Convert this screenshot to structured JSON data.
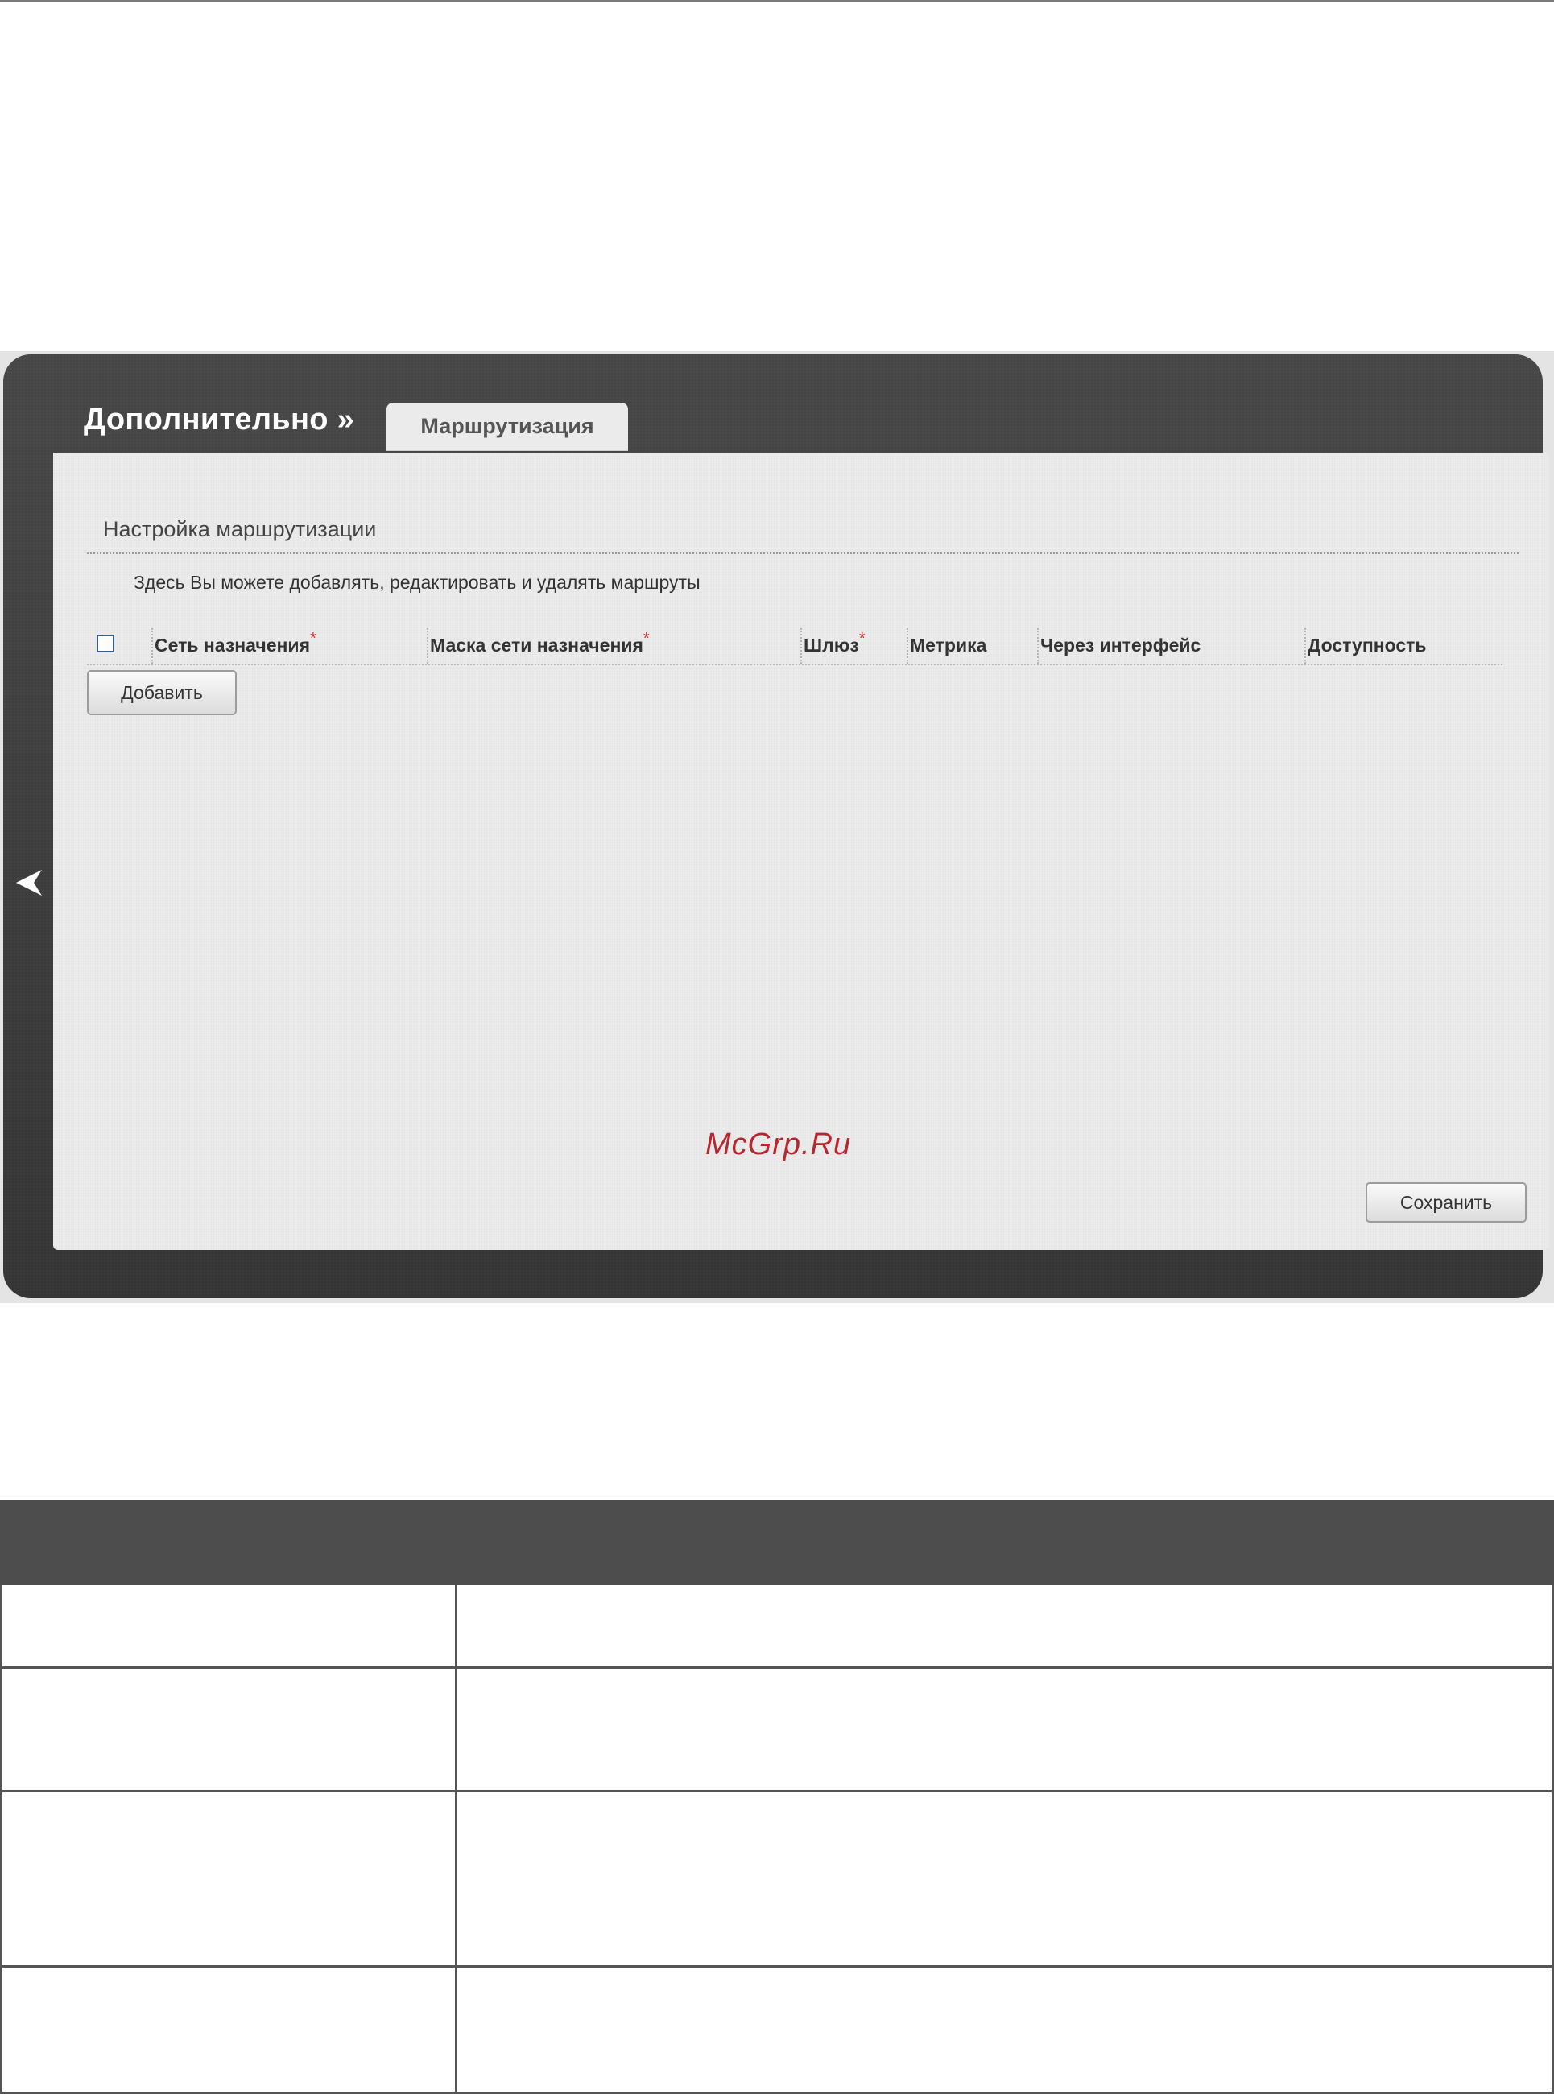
{
  "breadcrumb": {
    "parent": "Дополнительно »"
  },
  "tabs": {
    "active": "Маршрутизация"
  },
  "section": {
    "title": "Настройка маршрутизации",
    "description": "Здесь Вы можете добавлять, редактировать и удалять маршруты"
  },
  "table": {
    "columns": [
      {
        "label": "Сеть назначения",
        "required": "*"
      },
      {
        "label": "Маска сети назначения",
        "required": "*"
      },
      {
        "label": "Шлюз",
        "required": "*"
      },
      {
        "label": "Метрика",
        "required": ""
      },
      {
        "label": "Через интерфейс",
        "required": ""
      },
      {
        "label": "Доступность",
        "required": ""
      }
    ]
  },
  "buttons": {
    "add": "Добавить",
    "save": "Сохранить"
  },
  "watermark": "McGrp.Ru",
  "icons": {
    "back": "chevron-left-icon",
    "select_all": "checkbox-icon"
  }
}
